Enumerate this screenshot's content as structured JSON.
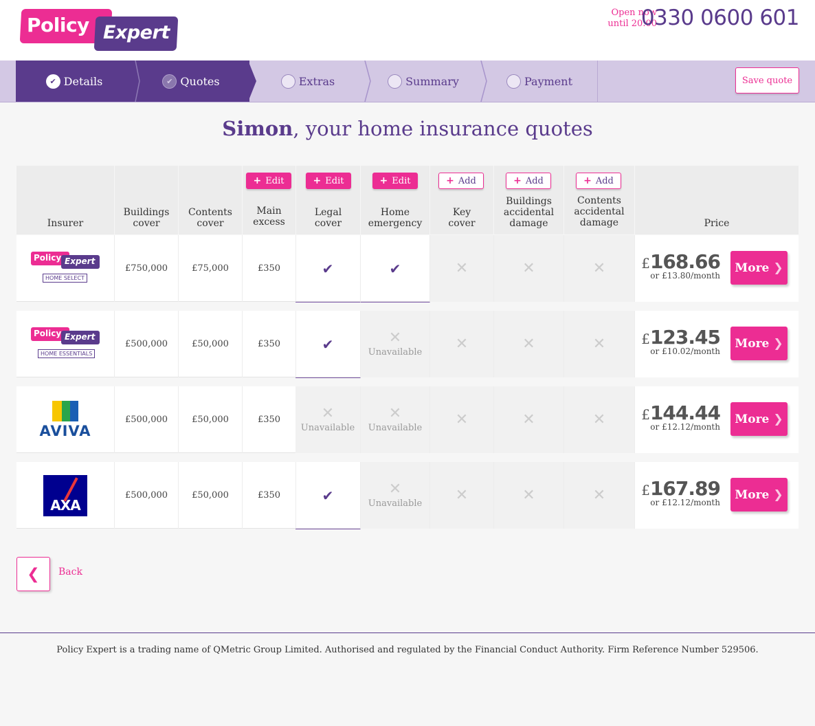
{
  "header": {
    "brand_word_1": "Policy",
    "brand_word_2": "Expert",
    "open_line_1": "Open now",
    "open_line_2": "until 20.00",
    "phone": "0330 0600 601"
  },
  "steps": [
    {
      "label": "Details",
      "state": "done"
    },
    {
      "label": "Quotes",
      "state": "current"
    },
    {
      "label": "Extras",
      "state": "todo"
    },
    {
      "label": "Summary",
      "state": "todo"
    },
    {
      "label": "Payment",
      "state": "todo"
    }
  ],
  "save_quote_label": "Save quote",
  "title": {
    "name": "Simon",
    "rest": ", your home insurance quotes"
  },
  "columns": {
    "insurer": "Insurer",
    "buildings_1": "Buildings",
    "buildings_2": "cover",
    "contents_1": "Contents",
    "contents_2": "cover",
    "excess_1": "Main",
    "excess_2": "excess",
    "legal_1": "Legal",
    "legal_2": "cover",
    "emergency_1": "Home",
    "emergency_2": "emergency",
    "key_1": "Key",
    "key_2": "cover",
    "bad_1": "Buildings",
    "bad_2": "accidental",
    "bad_3": "damage",
    "cad_1": "Contents",
    "cad_2": "accidental",
    "cad_3": "damage",
    "price": "Price"
  },
  "column_actions": {
    "edit": "Edit",
    "add": "Add",
    "plus": "+"
  },
  "unavailable_label": "Unavailable",
  "rows": [
    {
      "insurer": "Policy Expert Home Select",
      "logo_tag": "HOME SELECT",
      "buildings": "£750,000",
      "contents": "£75,000",
      "excess": "£350",
      "currency": "£",
      "price": "168.66",
      "monthly": "or £13.80/month"
    },
    {
      "insurer": "Policy Expert Home Essentials",
      "logo_tag": "HOME ESSENTIALS",
      "buildings": "£500,000",
      "contents": "£50,000",
      "excess": "£350",
      "currency": "£",
      "price": "123.45",
      "monthly": "or £10.02/month"
    },
    {
      "insurer": "Aviva",
      "logo_text": "AVIVA",
      "buildings": "£500,000",
      "contents": "£50,000",
      "excess": "£350",
      "currency": "£",
      "price": "144.44",
      "monthly": "or £12.12/month"
    },
    {
      "insurer": "AXA",
      "logo_text": "AXA",
      "buildings": "£500,000",
      "contents": "£50,000",
      "excess": "£350",
      "currency": "£",
      "price": "167.89",
      "monthly": "or £12.12/month"
    }
  ],
  "more_label": "More",
  "back_label": "Back",
  "footer": "Policy Expert is a trading name of QMetric Group Limited. Authorised and regulated by the Financial Conduct Authority. Firm Reference Number 529506.",
  "colors": {
    "pink": "#ec2d93",
    "purple": "#5a3b8c",
    "lilac": "#d3c8e4"
  },
  "icons": [
    "check-icon",
    "cross-icon",
    "chevron-right-icon",
    "chevron-left-icon",
    "plus-icon"
  ]
}
